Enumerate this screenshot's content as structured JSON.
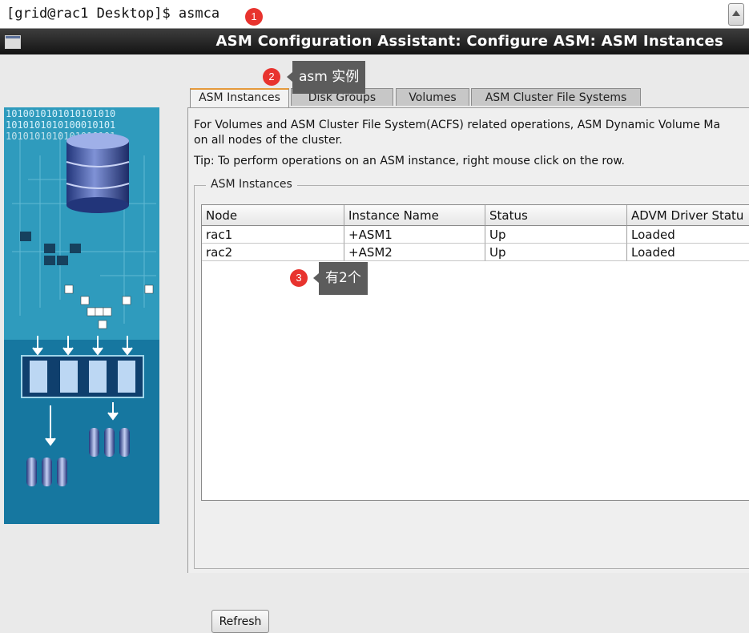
{
  "terminal": {
    "prompt": "[grid@rac1 Desktop]$ asmca"
  },
  "window": {
    "title": "ASM Configuration Assistant: Configure ASM: ASM Instances"
  },
  "art": {
    "binary_line_1": "1010010101010101010",
    "binary_line_2": "1010101010100010101",
    "binary_line_3": "1010101010101010101"
  },
  "tabs": [
    {
      "label": "ASM Instances",
      "active": true
    },
    {
      "label": "Disk Groups",
      "active": false
    },
    {
      "label": "Volumes",
      "active": false
    },
    {
      "label": "ASM Cluster File Systems",
      "active": false
    }
  ],
  "content": {
    "info_line1": "For Volumes and ASM Cluster File System(ACFS) related operations, ASM Dynamic Volume Ma",
    "info_line2": "on all nodes of the cluster.",
    "tip": "Tip: To perform operations on an ASM instance, right mouse click on the row.",
    "group_label": "ASM Instances",
    "refresh_label": "Refresh"
  },
  "table": {
    "columns": [
      "Node",
      "Instance Name",
      "Status",
      "ADVM Driver Statu"
    ],
    "rows": [
      [
        "rac1",
        "+ASM1",
        "Up",
        "Loaded"
      ],
      [
        "rac2",
        "+ASM2",
        "Up",
        "Loaded"
      ]
    ]
  },
  "annotations": [
    {
      "number": "1",
      "text": ""
    },
    {
      "number": "2",
      "text": "asm 实例"
    },
    {
      "number": "3",
      "text": "有2个"
    }
  ],
  "colors": {
    "badge": "#e8332e",
    "callout": "#5c5c5c",
    "active_tab_accent": "#e59a3c",
    "title_bar": "#1e1e1e"
  }
}
